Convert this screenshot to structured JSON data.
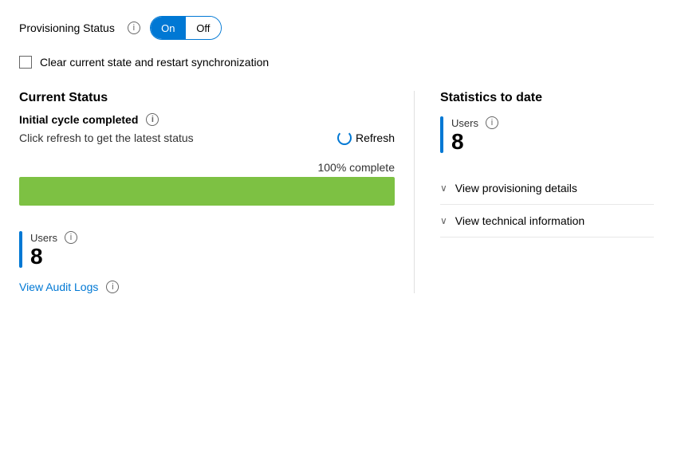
{
  "header": {
    "provisioning_status_label": "Provisioning Status",
    "toggle_on": "On",
    "toggle_off": "Off",
    "checkbox_label": "Clear current state and restart synchronization"
  },
  "left_panel": {
    "current_status_title": "Current Status",
    "cycle_label": "Initial cycle completed",
    "refresh_hint": "Click refresh to get the latest status",
    "refresh_button": "Refresh",
    "progress_label": "100% complete",
    "progress_percent": 100
  },
  "bottom_users": {
    "users_label": "Users",
    "users_count": "8",
    "audit_logs_link": "View Audit Logs"
  },
  "right_panel": {
    "stats_title": "Statistics to date",
    "users_label": "Users",
    "users_count": "8",
    "items": [
      {
        "label": "View provisioning details"
      },
      {
        "label": "View technical information"
      }
    ]
  },
  "icons": {
    "info": "ⓘ",
    "chevron_down": "∨",
    "refresh": "↻"
  }
}
